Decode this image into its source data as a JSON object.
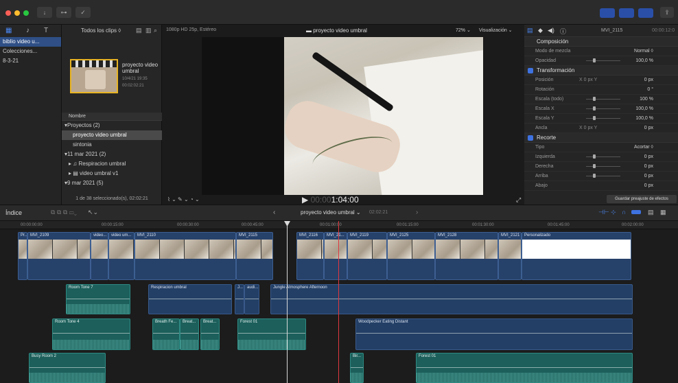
{
  "toolbar": {
    "import_icon": "↓",
    "key_icon": "⊶",
    "check_icon": "✓"
  },
  "library": {
    "items": [
      {
        "label": "biblio video u..."
      },
      {
        "label": "Colecciones..."
      },
      {
        "label": "8-3-21"
      }
    ]
  },
  "browser": {
    "filter": "Todos los clips ◊",
    "project_title": "proyecto video umbral",
    "project_date": "10/4/21 19:35",
    "project_dur": "00:02:02:21",
    "col_name": "Nombre",
    "rows": [
      {
        "label": "▾Proyectos  (2)"
      },
      {
        "label": "proyecto video umbral",
        "selected": true
      },
      {
        "label": "sintonia"
      },
      {
        "label": "▾11 mar 2021  (2)"
      },
      {
        "label": "▸ ♫  Respiracion umbral"
      },
      {
        "label": "▸ ▤  video umbral v1"
      },
      {
        "label": "▾9 mar 2021  (5)"
      }
    ],
    "status": "1 de 38 seleccionado(s), 02:02:21"
  },
  "viewer": {
    "format": "1080p HD 25p, Estéreo",
    "title": "proyecto video umbral",
    "zoom": "72% ⌄",
    "view_menu": "Visualización ⌄",
    "timecode_dim": "00:00",
    "timecode": "1:04:00",
    "tools": "⌇ ⌄  ✎ ⌄  ◔ ⌄"
  },
  "inspector": {
    "clip_name": "MVI_2115",
    "time": "00:00:12:0",
    "rows": [
      {
        "type": "sec",
        "label": "Composición",
        "plain": true
      },
      {
        "type": "row",
        "label": "Modo de mezcla",
        "val": "Normal ◊"
      },
      {
        "type": "row",
        "label": "Opacidad",
        "val": "100,0 %",
        "slider": true
      },
      {
        "type": "sec",
        "label": "Transformación"
      },
      {
        "type": "row",
        "label": "Posición",
        "c": "X        0 px    Y",
        "val": "0 px"
      },
      {
        "type": "row",
        "label": "Rotación",
        "val": "0 °"
      },
      {
        "type": "row",
        "label": "Escala (todo)",
        "val": "100 %",
        "slider": true
      },
      {
        "type": "row",
        "label": "Escala X",
        "val": "100,0 %",
        "slider": true
      },
      {
        "type": "row",
        "label": "Escala Y",
        "val": "100,0 %",
        "slider": true
      },
      {
        "type": "row",
        "label": "Ancla",
        "c": "X        0 px    Y",
        "val": "0 px"
      },
      {
        "type": "sec",
        "label": "Recorte"
      },
      {
        "type": "row",
        "label": "Tipo",
        "val": "Acortar ◊"
      },
      {
        "type": "row",
        "label": "Izquierda",
        "val": "0 px",
        "slider": true
      },
      {
        "type": "row",
        "label": "Derecha",
        "val": "0 px",
        "slider": true
      },
      {
        "type": "row",
        "label": "Arriba",
        "val": "0 px",
        "slider": true
      },
      {
        "type": "row",
        "label": "Abajo",
        "val": "0 px"
      }
    ],
    "save_button": "Guardar preajuste de efectos"
  },
  "timeline": {
    "index": "Índice",
    "project": "proyecto video umbral ⌄",
    "duration": "02:02:21",
    "ruler": [
      "00:00:00:00",
      "00:00:15:00",
      "00:00:30:00",
      "00:00:45:00",
      "00:01:00:00",
      "00:01:15:00",
      "00:01:30:00",
      "00:01:45:00",
      "00:02:00:00"
    ],
    "video_clips": [
      {
        "label": "Pr..."
      },
      {
        "label": "MVI_2109"
      },
      {
        "label": "video..."
      },
      {
        "label": "video um..."
      },
      {
        "label": "MVI_2110"
      },
      {
        "label": "MVI_2115"
      },
      {
        "label": "MVI_2116"
      },
      {
        "label": "MVI_21..."
      },
      {
        "label": "MVI_2119"
      },
      {
        "label": "MVI_2125"
      },
      {
        "label": "MVI_2128"
      },
      {
        "label": "MVI_2121"
      },
      {
        "label": "Personalizado"
      }
    ],
    "audio_clips": [
      {
        "label": "Room Tone 7"
      },
      {
        "label": "Respiracion umbral"
      },
      {
        "label": "J..."
      },
      {
        "label": "audi..."
      },
      {
        "label": "Jungle Atmosphere Afternoon"
      },
      {
        "label": "Room Tone 4"
      },
      {
        "label": "Breath Fe..."
      },
      {
        "label": "Breat..."
      },
      {
        "label": "Breat..."
      },
      {
        "label": "Forest 01"
      },
      {
        "label": "Woodpecker Eating Distant"
      },
      {
        "label": "Busy Room 2"
      },
      {
        "label": "Bir..."
      },
      {
        "label": "Forest 01"
      }
    ]
  },
  "colors": {
    "accent": "#3e72e0",
    "video_clip": "#26416a",
    "audio_clip": "#1c5f5b",
    "playhead": "#d9d9d9",
    "skimmer": "#e0383e"
  }
}
